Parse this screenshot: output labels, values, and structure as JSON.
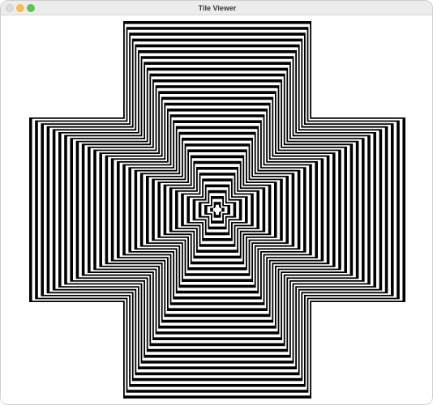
{
  "window": {
    "title": "Tile Viewer",
    "controls": [
      {
        "name": "close",
        "color": "#dcdcdc"
      },
      {
        "name": "minimize",
        "color": "#f5bf4f"
      },
      {
        "name": "maximize",
        "color": "#61c554"
      }
    ]
  },
  "tile": {
    "pattern": "concentric-cross",
    "colors": [
      "#000000",
      "#ffffff"
    ]
  }
}
